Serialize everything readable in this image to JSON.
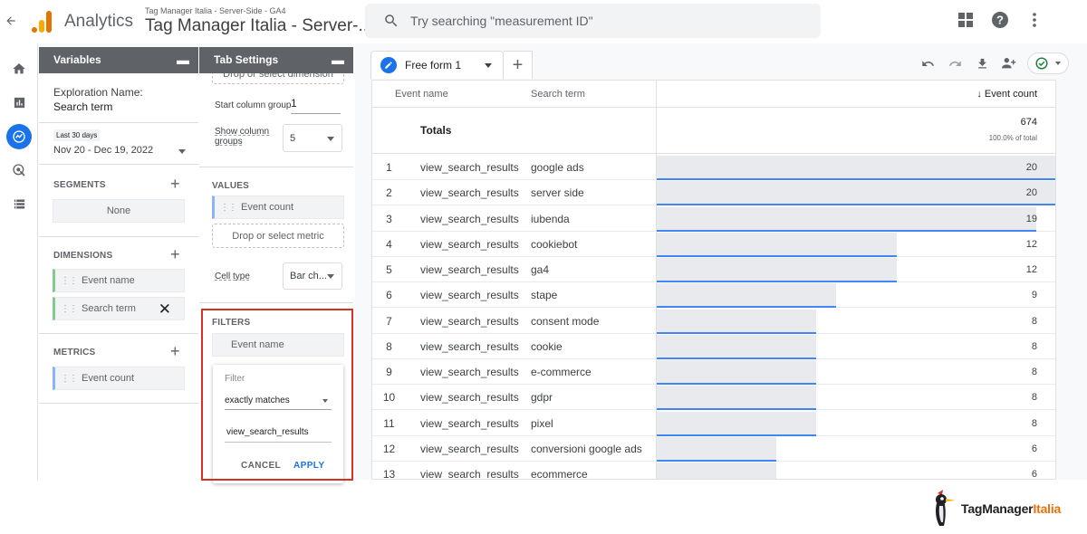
{
  "header": {
    "app_name": "Analytics",
    "account_path": "Tag Manager Italia - Server-Side - GA4",
    "property_name": "Tag Manager Italia - Server-...",
    "search_placeholder": "Try searching \"measurement ID\""
  },
  "icons": {
    "back": "arrow-left-icon",
    "search": "magnifier-icon",
    "apps": "apps-grid-icon",
    "help": "help-icon",
    "more": "more-vert-icon"
  },
  "nav_rail": [
    "home",
    "reports",
    "explore",
    "advertising",
    "configure"
  ],
  "variables": {
    "title": "Variables",
    "exploration_label": "Exploration Name:",
    "exploration_name": "Search term",
    "date_badge": "Last 30 days",
    "date_range": "Nov 20 - Dec 19, 2022",
    "segments_label": "SEGMENTS",
    "segments_none": "None",
    "dimensions_label": "DIMENSIONS",
    "dimensions": [
      "Event name",
      "Search term"
    ],
    "metrics_label": "METRICS",
    "metrics": [
      "Event count"
    ]
  },
  "tab_settings": {
    "title": "Tab Settings",
    "drop_dimension": "Drop or select dimension",
    "start_column_label": "Start column group",
    "start_column_value": "1",
    "show_groups_label": "Show column groups",
    "show_groups_value": "5",
    "values_label": "VALUES",
    "values": [
      "Event count"
    ],
    "drop_metric": "Drop or select metric",
    "cell_type_label": "Cell type",
    "cell_type_value": "Bar ch...",
    "filters_label": "FILTERS",
    "filter_dimension": "Event name",
    "filter_title": "Filter",
    "filter_match": "exactly matches",
    "filter_value": "view_search_results",
    "cancel_label": "CANCEL",
    "apply_label": "APPLY",
    "highlight_color": "#d93025"
  },
  "canvas": {
    "tab_label": "Free form 1",
    "add_tab": "+"
  },
  "table": {
    "columns": [
      "Event name",
      "Search term",
      "↓ Event count"
    ],
    "totals_label": "Totals",
    "totals_value": "674",
    "totals_pct": "100.0% of total",
    "max": 20,
    "rows": [
      {
        "n": "1",
        "event": "view_search_results",
        "term": "google ads",
        "count": 20
      },
      {
        "n": "2",
        "event": "view_search_results",
        "term": "server side",
        "count": 20
      },
      {
        "n": "3",
        "event": "view_search_results",
        "term": "iubenda",
        "count": 19
      },
      {
        "n": "4",
        "event": "view_search_results",
        "term": "cookiebot",
        "count": 12
      },
      {
        "n": "5",
        "event": "view_search_results",
        "term": "ga4",
        "count": 12
      },
      {
        "n": "6",
        "event": "view_search_results",
        "term": "stape",
        "count": 9
      },
      {
        "n": "7",
        "event": "view_search_results",
        "term": "consent mode",
        "count": 8
      },
      {
        "n": "8",
        "event": "view_search_results",
        "term": "cookie",
        "count": 8
      },
      {
        "n": "9",
        "event": "view_search_results",
        "term": "e-commerce",
        "count": 8
      },
      {
        "n": "10",
        "event": "view_search_results",
        "term": "gdpr",
        "count": 8
      },
      {
        "n": "11",
        "event": "view_search_results",
        "term": "pixel",
        "count": 8
      },
      {
        "n": "12",
        "event": "view_search_results",
        "term": "conversioni google ads",
        "count": 6
      },
      {
        "n": "13",
        "event": "view_search_results",
        "term": "ecommerce",
        "count": 6
      }
    ]
  },
  "watermark": {
    "part1": "TagManager",
    "part2": "Italia"
  }
}
